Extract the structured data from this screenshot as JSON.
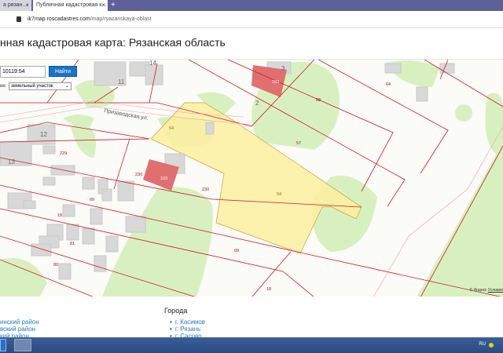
{
  "browser": {
    "tabs": [
      {
        "label": "а рязан…"
      },
      {
        "label": "Публичная кадастровая к…"
      }
    ],
    "new_tab": "+",
    "url_host": "ik7map.roscadastres.com",
    "url_path": "/map/ryazanskaya-oblast"
  },
  "page": {
    "title": "нная кадастровая карта: Рязанская область"
  },
  "search": {
    "value": "10119:54",
    "button": "Найти",
    "type_label": "ие:",
    "type_value": "земельный участок"
  },
  "map": {
    "street": "Призаводская ул.",
    "house_numbers": [
      "11",
      "14",
      "12",
      "13",
      "3",
      "2"
    ],
    "parcel_labels": [
      "229",
      "230",
      "230",
      "69",
      "18",
      "81",
      "80",
      "54",
      "54",
      "58",
      "57",
      "64",
      "69",
      "18"
    ],
    "building_labels": [
      "103",
      "103"
    ],
    "attribution": "© Яндекс",
    "terms": "Условия",
    "colors": {
      "selected_parcel": "#fbeea0",
      "parcel_border": "#d0182a",
      "building": "#dcdcdc",
      "green": "#d8f0c0",
      "red_building": "#e07070"
    }
  },
  "footer": {
    "districts": [
      "инский район",
      "вский район",
      "кий район"
    ],
    "cities_title": "Города",
    "cities": [
      "г. Касимов",
      "г. Рязань",
      "г. Сасово"
    ]
  },
  "taskbar": {
    "lang": "RU"
  }
}
